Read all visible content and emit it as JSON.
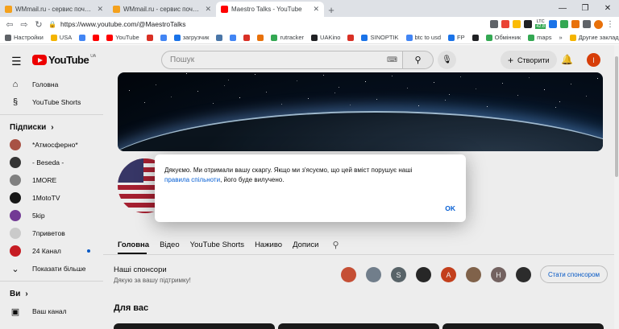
{
  "browser": {
    "tabs": [
      {
        "title": "WMmail.ru - сервис почтовых ро...",
        "active": false,
        "favicon_color": "#f4a11d"
      },
      {
        "title": "WMmail.ru - сервис почтовых ро...",
        "active": false,
        "favicon_color": "#f4a11d"
      },
      {
        "title": "Maestro Talks - YouTube",
        "active": true,
        "favicon_color": "#ff0000"
      }
    ],
    "new_tab": "+",
    "url": "https://www.youtube.com/@MaestroTalks",
    "ext_labels": {
      "ltc": "LTC",
      "ltc_value": "42.8"
    },
    "bookmarks": [
      {
        "label": "Настройки",
        "color": "#5f6368"
      },
      {
        "label": "USA",
        "color": "#f4b400"
      },
      {
        "label": "",
        "color": "#4285f4"
      },
      {
        "label": "",
        "color": "#ff0000"
      },
      {
        "label": "YouTube",
        "color": "#ff0000"
      },
      {
        "label": "",
        "color": "#d93025"
      },
      {
        "label": "",
        "color": "#4285f4"
      },
      {
        "label": "загрузчик",
        "color": "#1a73e8"
      },
      {
        "label": "",
        "color": "#4a76a8"
      },
      {
        "label": "",
        "color": "#4285f4"
      },
      {
        "label": "",
        "color": "#d93025"
      },
      {
        "label": "",
        "color": "#e8710a"
      },
      {
        "label": "rutracker",
        "color": "#34a853"
      },
      {
        "label": "UAKino",
        "color": "#202124"
      },
      {
        "label": "",
        "color": "#d93025"
      },
      {
        "label": "SINOPTIK",
        "color": "#1a73e8"
      },
      {
        "label": "btc to usd",
        "color": "#4285f4"
      },
      {
        "label": "FP",
        "color": "#1a73e8"
      },
      {
        "label": "",
        "color": "#202124"
      },
      {
        "label": "Обмінник",
        "color": "#34a853"
      },
      {
        "label": "maps",
        "color": "#34a853"
      }
    ],
    "bookmarks_more": "»",
    "other_bookmarks": "Другие закладки"
  },
  "youtube": {
    "logo": "YouTube",
    "logo_region": "UA",
    "search_placeholder": "Пошук",
    "create_label": "Створити",
    "account_initial": "I",
    "sidebar": {
      "top": [
        {
          "label": "Головна",
          "icon": "home-icon",
          "glyph": "⌂"
        },
        {
          "label": "YouTube Shorts",
          "icon": "shorts-icon",
          "glyph": "§"
        }
      ],
      "subs_header": "Підписки",
      "subs": [
        {
          "label": "*Атмосферно*",
          "color": "#b5594a",
          "live": false
        },
        {
          "label": "- Beseda -",
          "color": "#3a3a3a",
          "live": false
        },
        {
          "label": "1MORE",
          "color": "#8a8a8a",
          "live": false
        },
        {
          "label": "1MotoTV",
          "color": "#1a1a1a",
          "live": false
        },
        {
          "label": "5kip",
          "color": "#7b3fa0",
          "live": false
        },
        {
          "label": "7приветов",
          "color": "#dadada",
          "live": false
        },
        {
          "label": "24 Канал",
          "color": "#d61f26",
          "live": true
        }
      ],
      "show_more": "Показати більше",
      "you_header": "Ви",
      "you_first": "Ваш канал"
    },
    "channel_tabs": [
      "Головна",
      "Відео",
      "YouTube Shorts",
      "Наживо",
      "Дописи"
    ],
    "sponsors_title": "Наші спонсори",
    "sponsors_sub": "Дякую за вашу підтримку!",
    "sponsor_avatars": [
      {
        "letter": "",
        "color": "#d4563a"
      },
      {
        "letter": "",
        "color": "#7a8896"
      },
      {
        "letter": "S",
        "color": "#5f6b70"
      },
      {
        "letter": "",
        "color": "#2b2b2b"
      },
      {
        "letter": "A",
        "color": "#d2441f"
      },
      {
        "letter": "",
        "color": "#8a6a50"
      },
      {
        "letter": "H",
        "color": "#7c6a68"
      },
      {
        "letter": "",
        "color": "#303030"
      }
    ],
    "sponsor_button": "Стати спонсором",
    "for_you": "Для вас",
    "dialog": {
      "text_before": "Дякуємо. Ми отримали вашу скаргу. Якщо ми з'ясуємо, що цей вміст порушує наші",
      "link": "правила спільноти",
      "text_after": ", його буде вилучено.",
      "ok": "OK"
    }
  }
}
